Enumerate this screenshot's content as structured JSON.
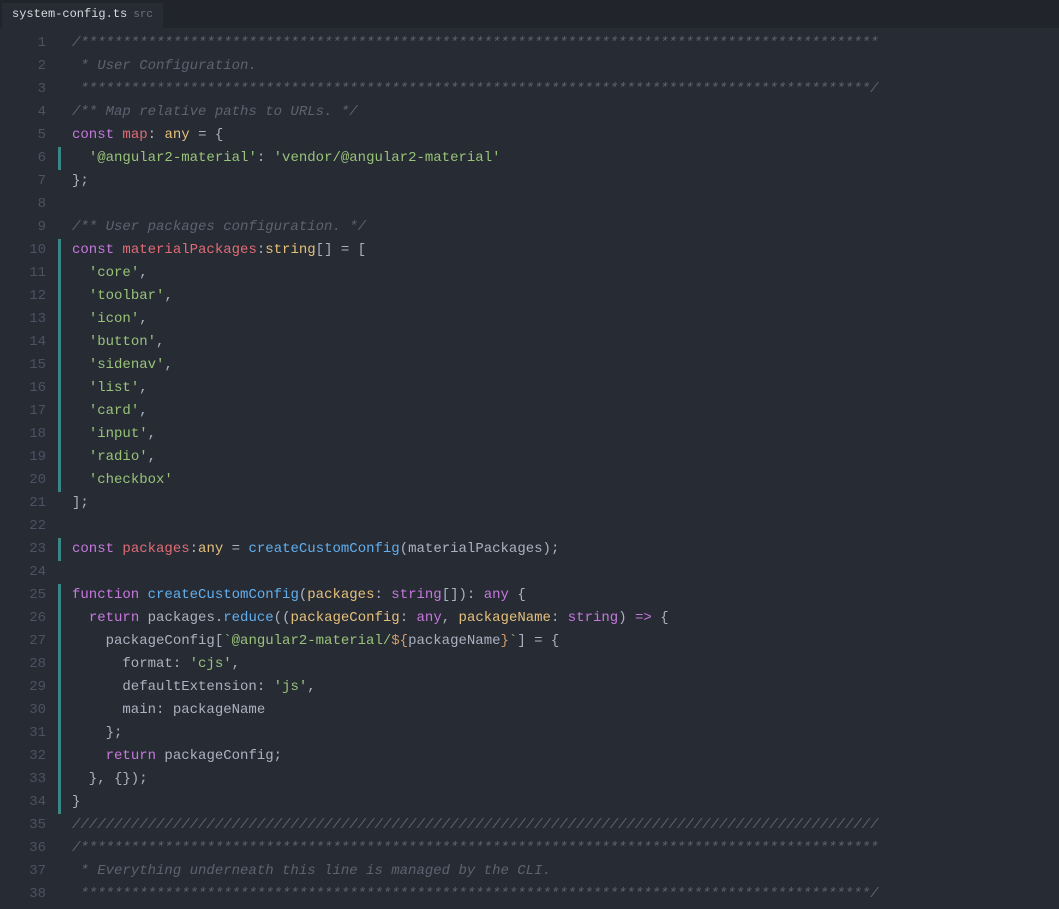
{
  "tab": {
    "name": "system-config.ts",
    "path": "src"
  },
  "lines": [
    {
      "n": 1,
      "m": false,
      "tokens": [
        [
          "c-comment",
          "/***********************************************************************************************"
        ]
      ]
    },
    {
      "n": 2,
      "m": false,
      "tokens": [
        [
          "c-comment",
          " * User Configuration."
        ]
      ]
    },
    {
      "n": 3,
      "m": false,
      "tokens": [
        [
          "c-comment",
          " **********************************************************************************************/"
        ]
      ]
    },
    {
      "n": 4,
      "m": false,
      "tokens": [
        [
          "c-comment",
          "/** Map relative paths to URLs. */"
        ]
      ]
    },
    {
      "n": 5,
      "m": false,
      "tokens": [
        [
          "c-kw",
          "const "
        ],
        [
          "c-var",
          "map"
        ],
        [
          "c-punct",
          ": "
        ],
        [
          "c-type",
          "any"
        ],
        [
          "c-punct",
          " = {"
        ]
      ]
    },
    {
      "n": 6,
      "m": true,
      "tokens": [
        [
          "c-punct",
          "  "
        ],
        [
          "c-str",
          "'@angular2-material'"
        ],
        [
          "c-punct",
          ": "
        ],
        [
          "c-str",
          "'vendor/@angular2-material'"
        ]
      ]
    },
    {
      "n": 7,
      "m": false,
      "tokens": [
        [
          "c-punct",
          "};"
        ]
      ]
    },
    {
      "n": 8,
      "m": false,
      "tokens": [
        [
          "",
          ""
        ]
      ]
    },
    {
      "n": 9,
      "m": false,
      "tokens": [
        [
          "c-comment",
          "/** User packages configuration. */"
        ]
      ]
    },
    {
      "n": 10,
      "m": true,
      "tokens": [
        [
          "c-kw",
          "const "
        ],
        [
          "c-var",
          "materialPackages"
        ],
        [
          "c-punct",
          ":"
        ],
        [
          "c-type",
          "string"
        ],
        [
          "c-punct",
          "[] = ["
        ]
      ]
    },
    {
      "n": 11,
      "m": true,
      "tokens": [
        [
          "c-punct",
          "  "
        ],
        [
          "c-str",
          "'core'"
        ],
        [
          "c-punct",
          ","
        ]
      ]
    },
    {
      "n": 12,
      "m": true,
      "tokens": [
        [
          "c-punct",
          "  "
        ],
        [
          "c-str",
          "'toolbar'"
        ],
        [
          "c-punct",
          ","
        ]
      ]
    },
    {
      "n": 13,
      "m": true,
      "tokens": [
        [
          "c-punct",
          "  "
        ],
        [
          "c-str",
          "'icon'"
        ],
        [
          "c-punct",
          ","
        ]
      ]
    },
    {
      "n": 14,
      "m": true,
      "tokens": [
        [
          "c-punct",
          "  "
        ],
        [
          "c-str",
          "'button'"
        ],
        [
          "c-punct",
          ","
        ]
      ]
    },
    {
      "n": 15,
      "m": true,
      "tokens": [
        [
          "c-punct",
          "  "
        ],
        [
          "c-str",
          "'sidenav'"
        ],
        [
          "c-punct",
          ","
        ]
      ]
    },
    {
      "n": 16,
      "m": true,
      "tokens": [
        [
          "c-punct",
          "  "
        ],
        [
          "c-str",
          "'list'"
        ],
        [
          "c-punct",
          ","
        ]
      ]
    },
    {
      "n": 17,
      "m": true,
      "tokens": [
        [
          "c-punct",
          "  "
        ],
        [
          "c-str",
          "'card'"
        ],
        [
          "c-punct",
          ","
        ]
      ]
    },
    {
      "n": 18,
      "m": true,
      "tokens": [
        [
          "c-punct",
          "  "
        ],
        [
          "c-str",
          "'input'"
        ],
        [
          "c-punct",
          ","
        ]
      ]
    },
    {
      "n": 19,
      "m": true,
      "tokens": [
        [
          "c-punct",
          "  "
        ],
        [
          "c-str",
          "'radio'"
        ],
        [
          "c-punct",
          ","
        ]
      ]
    },
    {
      "n": 20,
      "m": true,
      "tokens": [
        [
          "c-punct",
          "  "
        ],
        [
          "c-str",
          "'checkbox'"
        ]
      ]
    },
    {
      "n": 21,
      "m": false,
      "tokens": [
        [
          "c-punct",
          "];"
        ]
      ]
    },
    {
      "n": 22,
      "m": false,
      "tokens": [
        [
          "",
          ""
        ]
      ]
    },
    {
      "n": 23,
      "m": true,
      "tokens": [
        [
          "c-kw",
          "const "
        ],
        [
          "c-var",
          "packages"
        ],
        [
          "c-punct",
          ":"
        ],
        [
          "c-type",
          "any"
        ],
        [
          "c-punct",
          " = "
        ],
        [
          "c-fn",
          "createCustomConfig"
        ],
        [
          "c-punct",
          "(materialPackages);"
        ]
      ]
    },
    {
      "n": 24,
      "m": false,
      "tokens": [
        [
          "",
          ""
        ]
      ]
    },
    {
      "n": 25,
      "m": true,
      "tokens": [
        [
          "c-kw",
          "function "
        ],
        [
          "c-fn",
          "createCustomConfig"
        ],
        [
          "c-punct",
          "("
        ],
        [
          "c-param",
          "packages"
        ],
        [
          "c-punct",
          ": "
        ],
        [
          "c-ptype",
          "string"
        ],
        [
          "c-punct",
          "[]): "
        ],
        [
          "c-ptype",
          "any"
        ],
        [
          "c-punct",
          " {"
        ]
      ]
    },
    {
      "n": 26,
      "m": true,
      "tokens": [
        [
          "c-punct",
          "  "
        ],
        [
          "c-kw",
          "return"
        ],
        [
          "c-punct",
          " packages."
        ],
        [
          "c-fn",
          "reduce"
        ],
        [
          "c-punct",
          "(("
        ],
        [
          "c-param",
          "packageConfig"
        ],
        [
          "c-punct",
          ": "
        ],
        [
          "c-ptype",
          "any"
        ],
        [
          "c-punct",
          ", "
        ],
        [
          "c-param",
          "packageName"
        ],
        [
          "c-punct",
          ": "
        ],
        [
          "c-ptype",
          "string"
        ],
        [
          "c-punct",
          ") "
        ],
        [
          "c-kw",
          "=>"
        ],
        [
          "c-punct",
          " {"
        ]
      ]
    },
    {
      "n": 27,
      "m": true,
      "tokens": [
        [
          "c-punct",
          "    packageConfig["
        ],
        [
          "c-str",
          "`@angular2-material/"
        ],
        [
          "c-templ",
          "${"
        ],
        [
          "c-punct",
          "packageName"
        ],
        [
          "c-templ",
          "}"
        ],
        [
          "c-str",
          "`"
        ],
        [
          "c-punct",
          "] = {"
        ]
      ]
    },
    {
      "n": 28,
      "m": true,
      "tokens": [
        [
          "c-punct",
          "      format: "
        ],
        [
          "c-str",
          "'cjs'"
        ],
        [
          "c-punct",
          ","
        ]
      ]
    },
    {
      "n": 29,
      "m": true,
      "tokens": [
        [
          "c-punct",
          "      defaultExtension: "
        ],
        [
          "c-str",
          "'js'"
        ],
        [
          "c-punct",
          ","
        ]
      ]
    },
    {
      "n": 30,
      "m": true,
      "tokens": [
        [
          "c-punct",
          "      main: packageName"
        ]
      ]
    },
    {
      "n": 31,
      "m": true,
      "tokens": [
        [
          "c-punct",
          "    };"
        ]
      ]
    },
    {
      "n": 32,
      "m": true,
      "tokens": [
        [
          "c-punct",
          "    "
        ],
        [
          "c-kw",
          "return"
        ],
        [
          "c-punct",
          " packageConfig;"
        ]
      ]
    },
    {
      "n": 33,
      "m": true,
      "tokens": [
        [
          "c-punct",
          "  }, {});"
        ]
      ]
    },
    {
      "n": 34,
      "m": true,
      "tokens": [
        [
          "c-punct",
          "}"
        ]
      ]
    },
    {
      "n": 35,
      "m": false,
      "tokens": [
        [
          "c-comment",
          "////////////////////////////////////////////////////////////////////////////////////////////////"
        ]
      ]
    },
    {
      "n": 36,
      "m": false,
      "tokens": [
        [
          "c-comment",
          "/***********************************************************************************************"
        ]
      ]
    },
    {
      "n": 37,
      "m": false,
      "tokens": [
        [
          "c-comment",
          " * Everything underneath this line is managed by the CLI."
        ]
      ]
    },
    {
      "n": 38,
      "m": false,
      "tokens": [
        [
          "c-comment",
          " **********************************************************************************************/"
        ]
      ]
    }
  ]
}
